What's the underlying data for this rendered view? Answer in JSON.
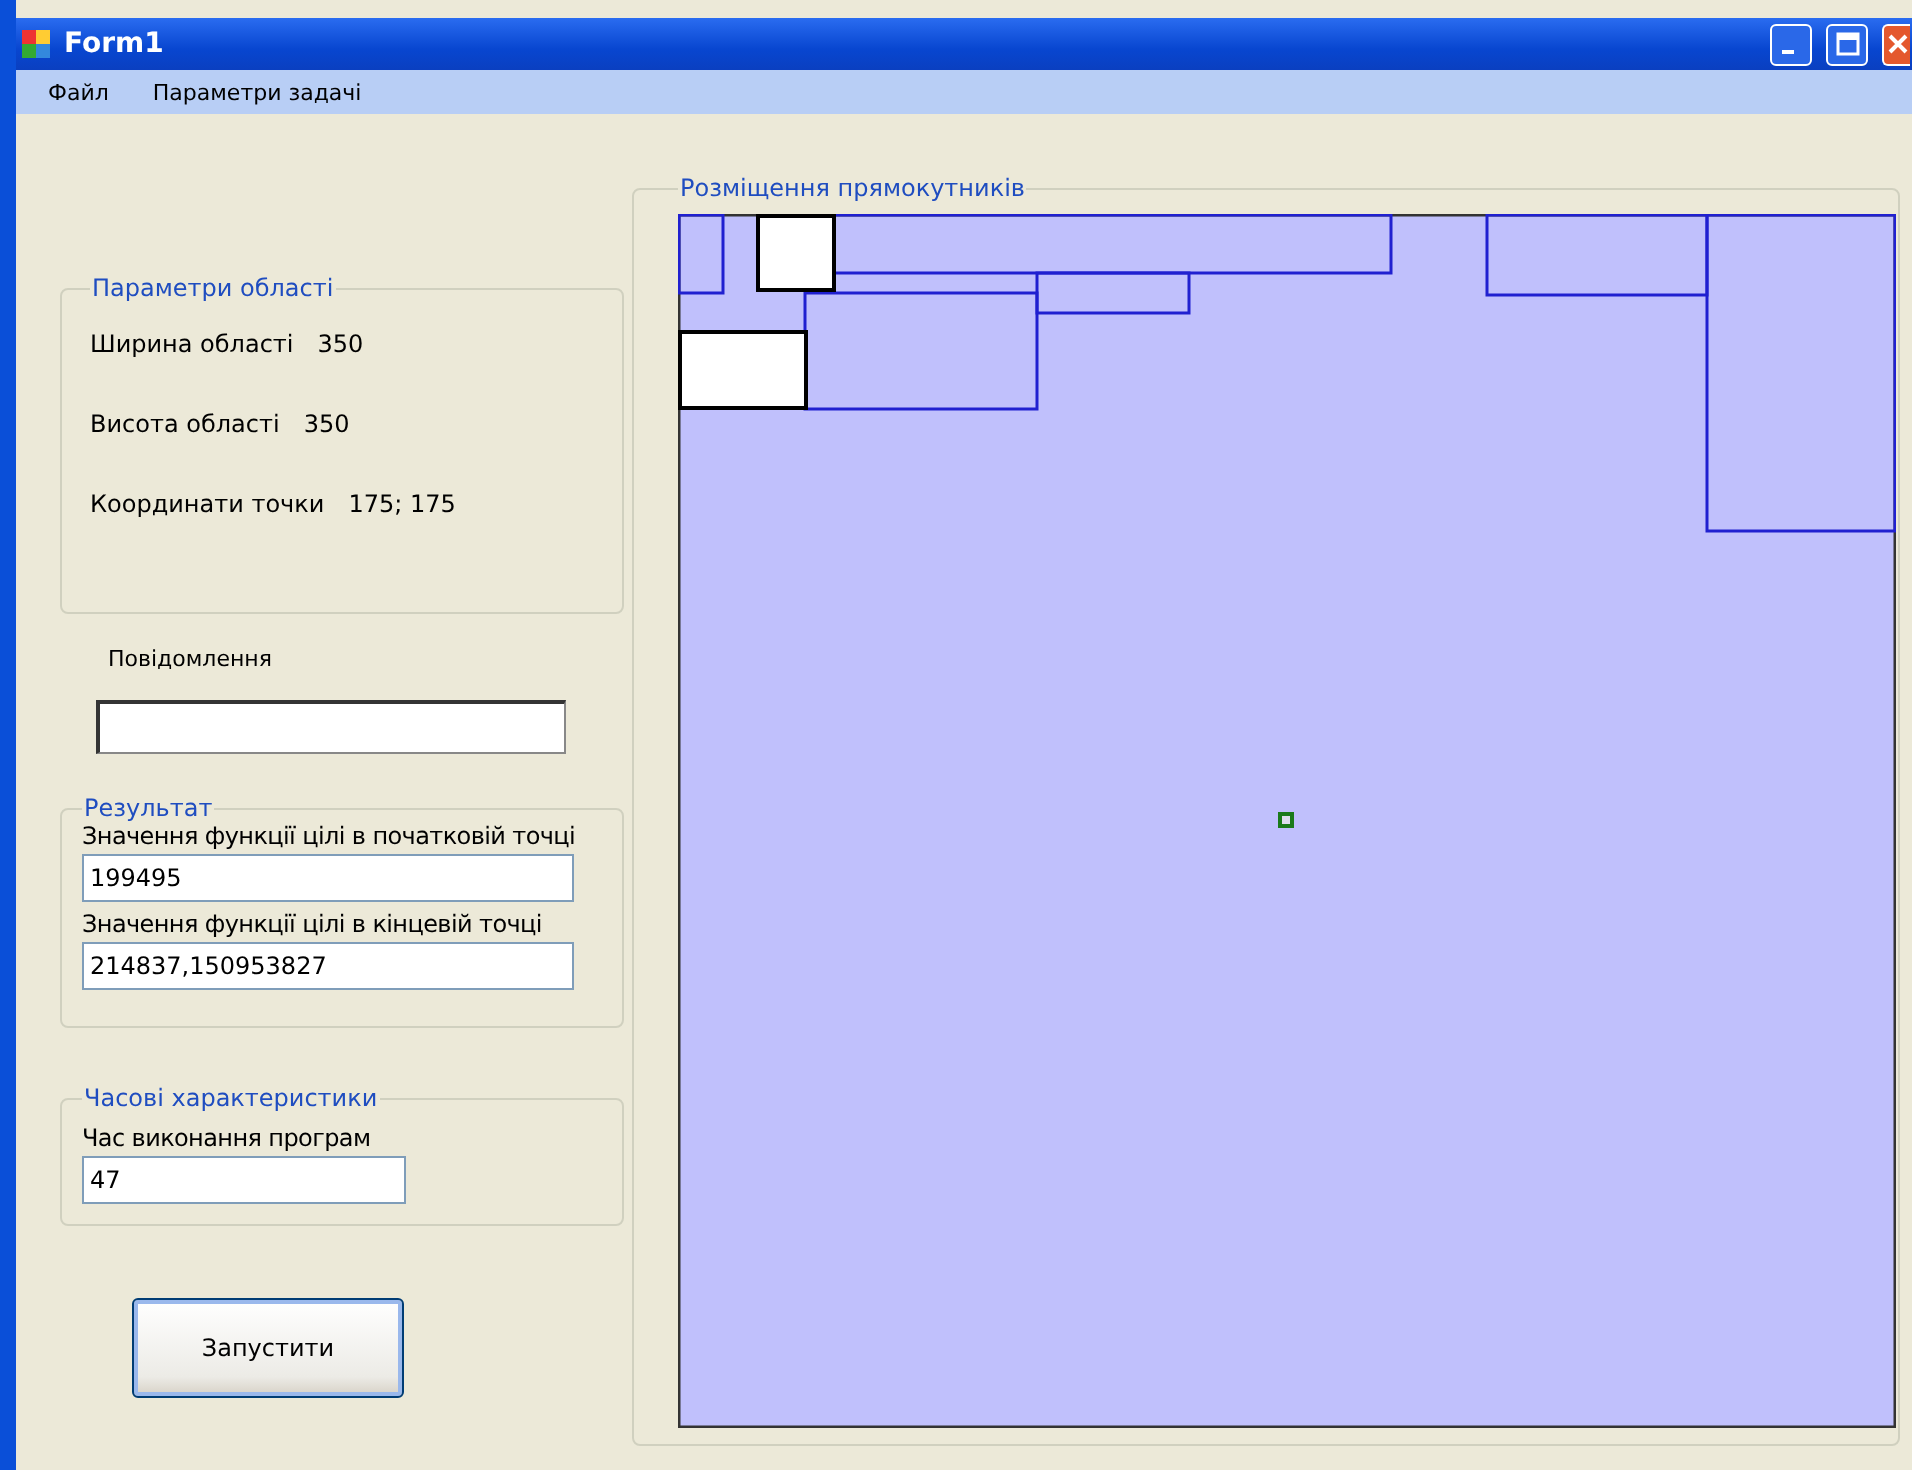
{
  "window": {
    "title": "Form1"
  },
  "menu": [
    "Файл",
    "Параметри задачі"
  ],
  "area_group": {
    "title": "Параметри області",
    "rows": [
      {
        "label": "Ширина області",
        "value": "350"
      },
      {
        "label": "Висота області",
        "value": "350"
      },
      {
        "label": "Координати точки",
        "value": "175;  175"
      }
    ]
  },
  "message": {
    "label": "Повідомлення"
  },
  "result_group": {
    "title": "Результат",
    "fields": [
      {
        "label": "Значення функції цілі в початковій точці",
        "value": "199495"
      },
      {
        "label": "Значення функції цілі в кінцевій точці",
        "value": "214837,150953827"
      }
    ]
  },
  "time_group": {
    "title": "Часові характеристики",
    "fields": [
      {
        "label": "Час виконання програм",
        "value": "47"
      }
    ]
  },
  "run_button": "Запустити",
  "placement_group": {
    "title": "Розміщення прямокутників"
  }
}
